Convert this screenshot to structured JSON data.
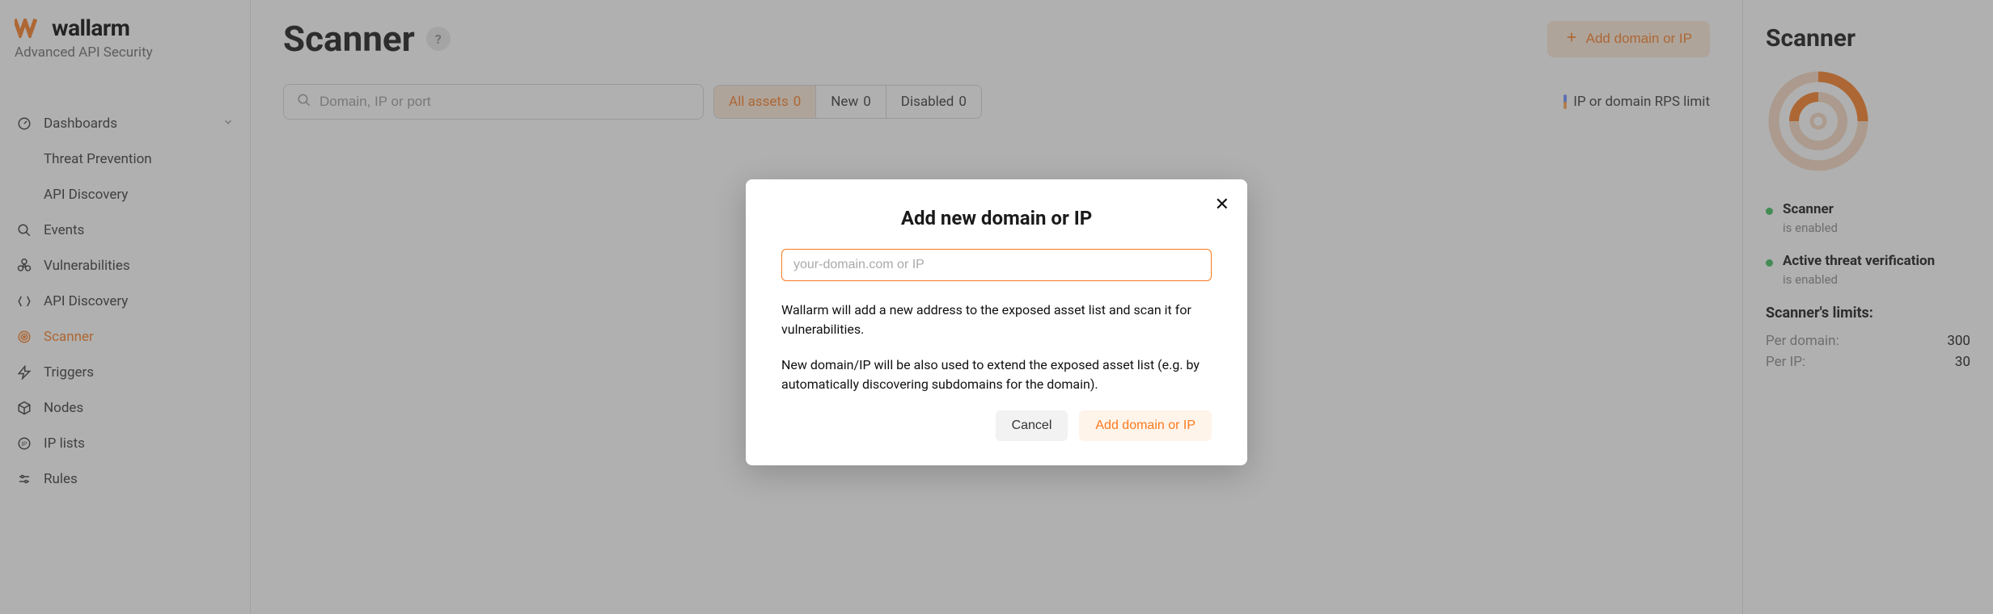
{
  "brand": {
    "name": "wallarm",
    "tagline": "Advanced API Security"
  },
  "sidebar": {
    "items": [
      {
        "label": "Dashboards",
        "has_children": true
      },
      {
        "label": "Threat Prevention"
      },
      {
        "label": "API Discovery"
      },
      {
        "label": "Events"
      },
      {
        "label": "Vulnerabilities"
      },
      {
        "label": "API Discovery"
      },
      {
        "label": "Scanner",
        "active": true
      },
      {
        "label": "Triggers"
      },
      {
        "label": "Nodes"
      },
      {
        "label": "IP lists"
      },
      {
        "label": "Rules"
      }
    ]
  },
  "main": {
    "title": "Scanner",
    "add_btn": "Add domain or IP",
    "search_placeholder": "Domain, IP or port",
    "filters": {
      "all_label": "All assets",
      "all_count": "0",
      "new_label": "New",
      "new_count": "0",
      "disabled_label": "Disabled",
      "disabled_count": "0"
    },
    "rps_limit": "IP or domain RPS limit"
  },
  "right": {
    "title": "Scanner",
    "scanner_label": "Scanner",
    "scanner_status": "is enabled",
    "threat_label": "Active threat verification",
    "threat_status": "is enabled",
    "limits_title": "Scanner's limits:",
    "per_domain_label": "Per domain:",
    "per_domain_value": "300",
    "per_ip_label": "Per IP:",
    "per_ip_value": "30"
  },
  "modal": {
    "title": "Add new domain or IP",
    "placeholder": "your-domain.com or IP",
    "text1": "Wallarm will add a new address to the exposed asset list and scan it for vulnerabilities.",
    "text2": "New domain/IP will be also used to extend the exposed asset list (e.g. by automatically discovering subdomains for the domain).",
    "cancel": "Cancel",
    "confirm": "Add domain or IP"
  },
  "colors": {
    "accent": "#fa7a1e"
  }
}
